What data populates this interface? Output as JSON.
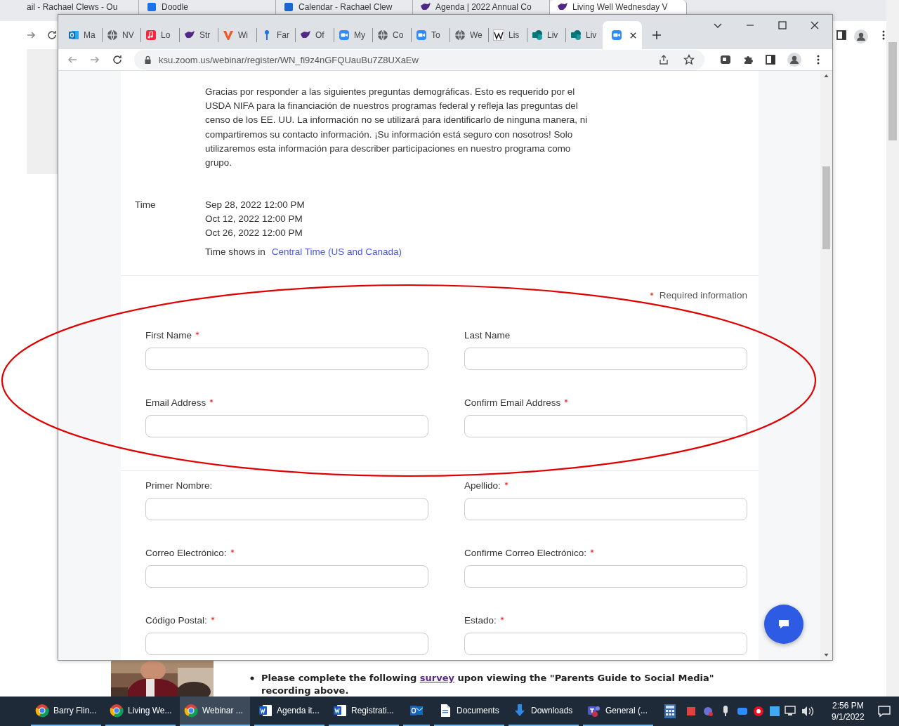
{
  "background_browser": {
    "tabs": [
      {
        "title": "ail - Rachael Clews - Ou",
        "kind": "plain",
        "selected": false
      },
      {
        "title": "Doodle",
        "kind": "page",
        "selected": false
      },
      {
        "title": "Calendar - Rachael Clew",
        "kind": "calendar",
        "selected": false
      },
      {
        "title": "Agenda | 2022 Annual Co",
        "kind": "wildcat",
        "selected": false
      },
      {
        "title": "Living Well Wednesday V",
        "kind": "wildcat",
        "selected": true
      }
    ],
    "page": {
      "before_link": "Please complete the following",
      "link": "survey",
      "after_link": "upon viewing the \"Parents Guide to Social Media\" recording above."
    }
  },
  "browser": {
    "tabs": [
      {
        "label": "Ma",
        "kind": "mail",
        "selected": false
      },
      {
        "label": "NV",
        "kind": "globe",
        "selected": false
      },
      {
        "label": "Lo",
        "kind": "music",
        "selected": false
      },
      {
        "label": "Str",
        "kind": "wildcat",
        "selected": false
      },
      {
        "label": "Wi",
        "kind": "vee",
        "selected": false
      },
      {
        "label": "Far",
        "kind": "pin",
        "selected": false
      },
      {
        "label": "Of",
        "kind": "wildcat",
        "selected": false
      },
      {
        "label": "My",
        "kind": "video",
        "selected": false
      },
      {
        "label": "Co",
        "kind": "globe",
        "selected": false
      },
      {
        "label": "To",
        "kind": "video",
        "selected": false
      },
      {
        "label": "We",
        "kind": "globe",
        "selected": false
      },
      {
        "label": "Lis",
        "kind": "wiki",
        "selected": false
      },
      {
        "label": "Liv",
        "kind": "share",
        "selected": false
      },
      {
        "label": "Liv",
        "kind": "share",
        "selected": false
      },
      {
        "kind": "video",
        "selected": true
      }
    ],
    "address": "ksu.zoom.us/webinar/register/WN_fi9z4nGFQUauBu7Z8UXaEw"
  },
  "intro": "Gracias por responder a las siguientes preguntas demográficas. Esto es requerido por el USDA NIFA para la financiación de nuestros programas federal y refleja las preguntas del censo de los EE. UU. La información no se utilizará para identificarlo de ninguna manera, ni compartiremos su contacto información. ¡Su información está seguro con nosotros! Solo utilizaremos esta información para describer participaciones en nuestro programa como grupo.",
  "time": {
    "label": "Time",
    "dates": [
      "Sep 28, 2022 12:00 PM",
      "Oct 12, 2022 12:00 PM",
      "Oct 26, 2022 12:00 PM"
    ],
    "zone_prefix": "Time shows in",
    "zone_link": "Central Time (US and Canada)"
  },
  "required_note": "Required information",
  "field_groups": [
    [
      {
        "label": "First Name",
        "required": true
      },
      {
        "label": "Last Name",
        "required": false
      },
      {
        "label": "Email Address",
        "required": true
      },
      {
        "label": "Confirm Email Address",
        "required": true
      }
    ],
    [
      {
        "label": "Primer Nombre:",
        "required": false
      },
      {
        "label": "Apellido:",
        "required": true
      },
      {
        "label": "Correo Electrónico:",
        "required": true
      },
      {
        "label": "Confirme Correo Electrónico:",
        "required": true
      },
      {
        "label": "Código Postal:",
        "required": true
      },
      {
        "label": "Estado:",
        "required": true
      }
    ]
  ],
  "taskbar": {
    "items": [
      {
        "label": "Barry Flin...",
        "kind": "chrome",
        "selected": false
      },
      {
        "label": "Living We...",
        "kind": "chrome",
        "selected": false
      },
      {
        "label": "Webinar ...",
        "kind": "chrome",
        "selected": true
      },
      {
        "label": "Agenda it...",
        "kind": "word",
        "selected": false
      },
      {
        "label": "Registrati...",
        "kind": "word",
        "selected": false
      },
      {
        "kind": "outlook",
        "selected": false
      },
      {
        "label": "Documents",
        "kind": "file",
        "selected": false
      },
      {
        "label": "Downloads",
        "kind": "download",
        "selected": false
      },
      {
        "label": "General (...",
        "kind": "teams",
        "selected": false
      }
    ],
    "time": "2:56 PM",
    "date": "9/1/2022"
  }
}
